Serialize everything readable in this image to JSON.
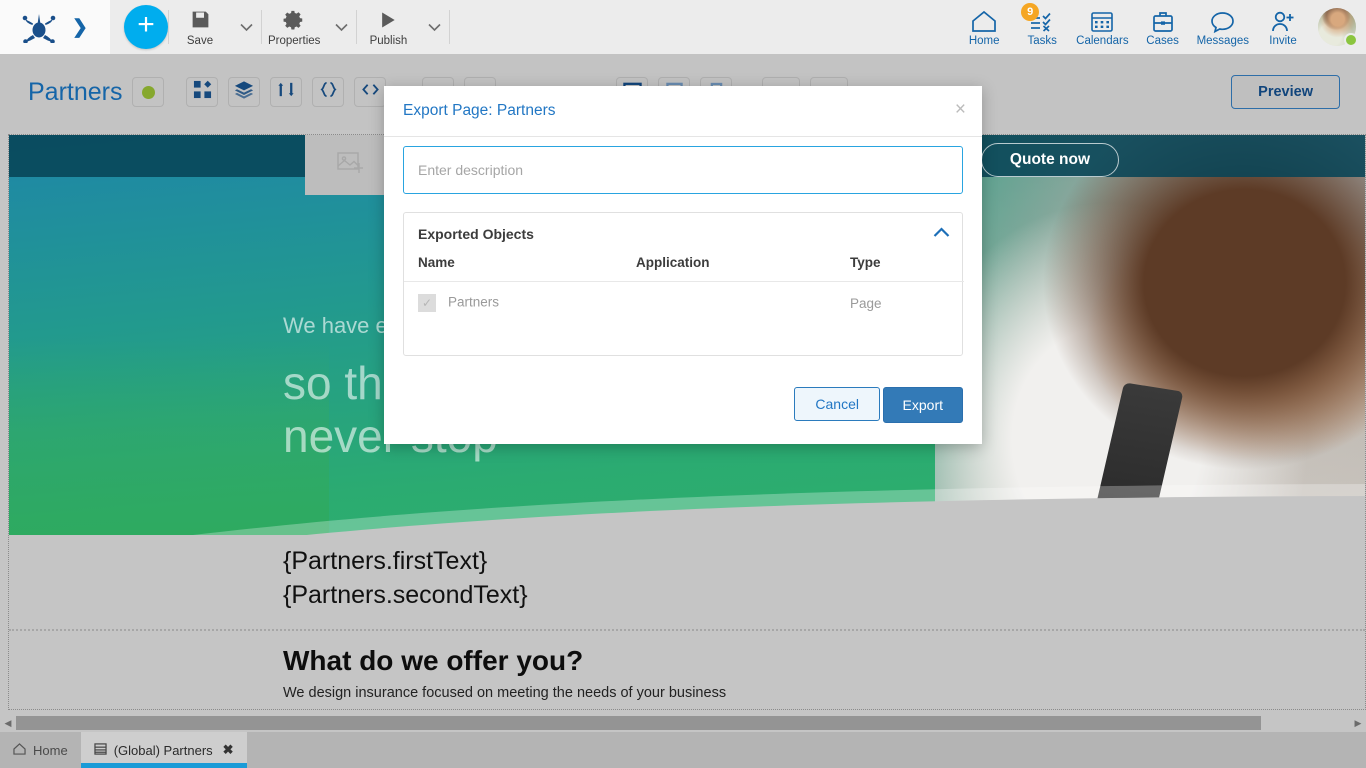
{
  "toolbar": {
    "logo_icon": "frog-logo-icon",
    "expand_icon": "chevron-right-icon",
    "add_label": "+",
    "items": [
      {
        "label": "Save",
        "icon": "save-floppy-icon"
      },
      {
        "label": "Properties",
        "icon": "gear-icon"
      },
      {
        "label": "Publish",
        "icon": "play-triangle-icon"
      }
    ],
    "nav": [
      {
        "label": "Home",
        "icon": "home-icon",
        "badge": ""
      },
      {
        "label": "Tasks",
        "icon": "tasks-checklist-icon",
        "badge": "9"
      },
      {
        "label": "Calendars",
        "icon": "calendar-icon",
        "badge": ""
      },
      {
        "label": "Cases",
        "icon": "briefcase-icon",
        "badge": ""
      },
      {
        "label": "Messages",
        "icon": "speech-bubble-icon",
        "badge": ""
      },
      {
        "label": "Invite",
        "icon": "person-plus-icon",
        "badge": ""
      }
    ],
    "avatar_name": "user-avatar",
    "avatar_status": "online"
  },
  "page_header": {
    "title": "Partners",
    "status_dot_color": "#86a82e",
    "buttons": [
      {
        "name": "widgets-grid-icon"
      },
      {
        "name": "layers-icon"
      },
      {
        "name": "flow-icon"
      },
      {
        "name": "braces-icon"
      },
      {
        "name": "code-icon"
      }
    ],
    "device_buttons": [
      {
        "name": "desktop-icon"
      },
      {
        "name": "tablet-icon"
      },
      {
        "name": "mobile-icon"
      }
    ],
    "preview_label": "Preview"
  },
  "canvas": {
    "hero": {
      "logo_placeholder_icon": "image-placeholder-icon",
      "quote_button": "Quote now",
      "kicker": "We have e",
      "headline_line1": "so th",
      "headline_line2": "never stop"
    },
    "body": {
      "template_line1": "{Partners.firstText}",
      "template_line2": "{Partners.secondText}",
      "offer_heading": "What do we offer you?",
      "offer_subtext": "We design insurance focused on meeting the needs of your business"
    }
  },
  "modal": {
    "title": "Export Page: Partners",
    "close_icon": "close-icon",
    "description_placeholder": "Enter description",
    "description_value": "",
    "exported_objects": {
      "section_label": "Exported Objects",
      "collapse_icon": "chevron-up-icon",
      "columns": [
        "Name",
        "Application",
        "Type"
      ],
      "rows": [
        {
          "checked": true,
          "name": "Partners",
          "application": "",
          "type": "Page"
        }
      ]
    },
    "cancel_label": "Cancel",
    "export_label": "Export"
  },
  "bottom": {
    "scroll_left_icon": "scroll-left-arrow-icon",
    "scroll_right_icon": "scroll-right-arrow-icon",
    "tabs": [
      {
        "label": "Home",
        "icon": "home-outline-icon",
        "active": false,
        "closable": false
      },
      {
        "label": "(Global) Partners",
        "icon": "page-icon",
        "active": true,
        "closable": true,
        "close_icon": "close-x-icon"
      }
    ]
  },
  "colors": {
    "accent_blue": "#00adee",
    "link_blue": "#1565a8",
    "primary_button": "#337ab7",
    "badge_orange": "#f5a623",
    "status_green": "#8bc53f",
    "hero_teal": "#1e86a8",
    "hero_green": "#2eb367"
  }
}
